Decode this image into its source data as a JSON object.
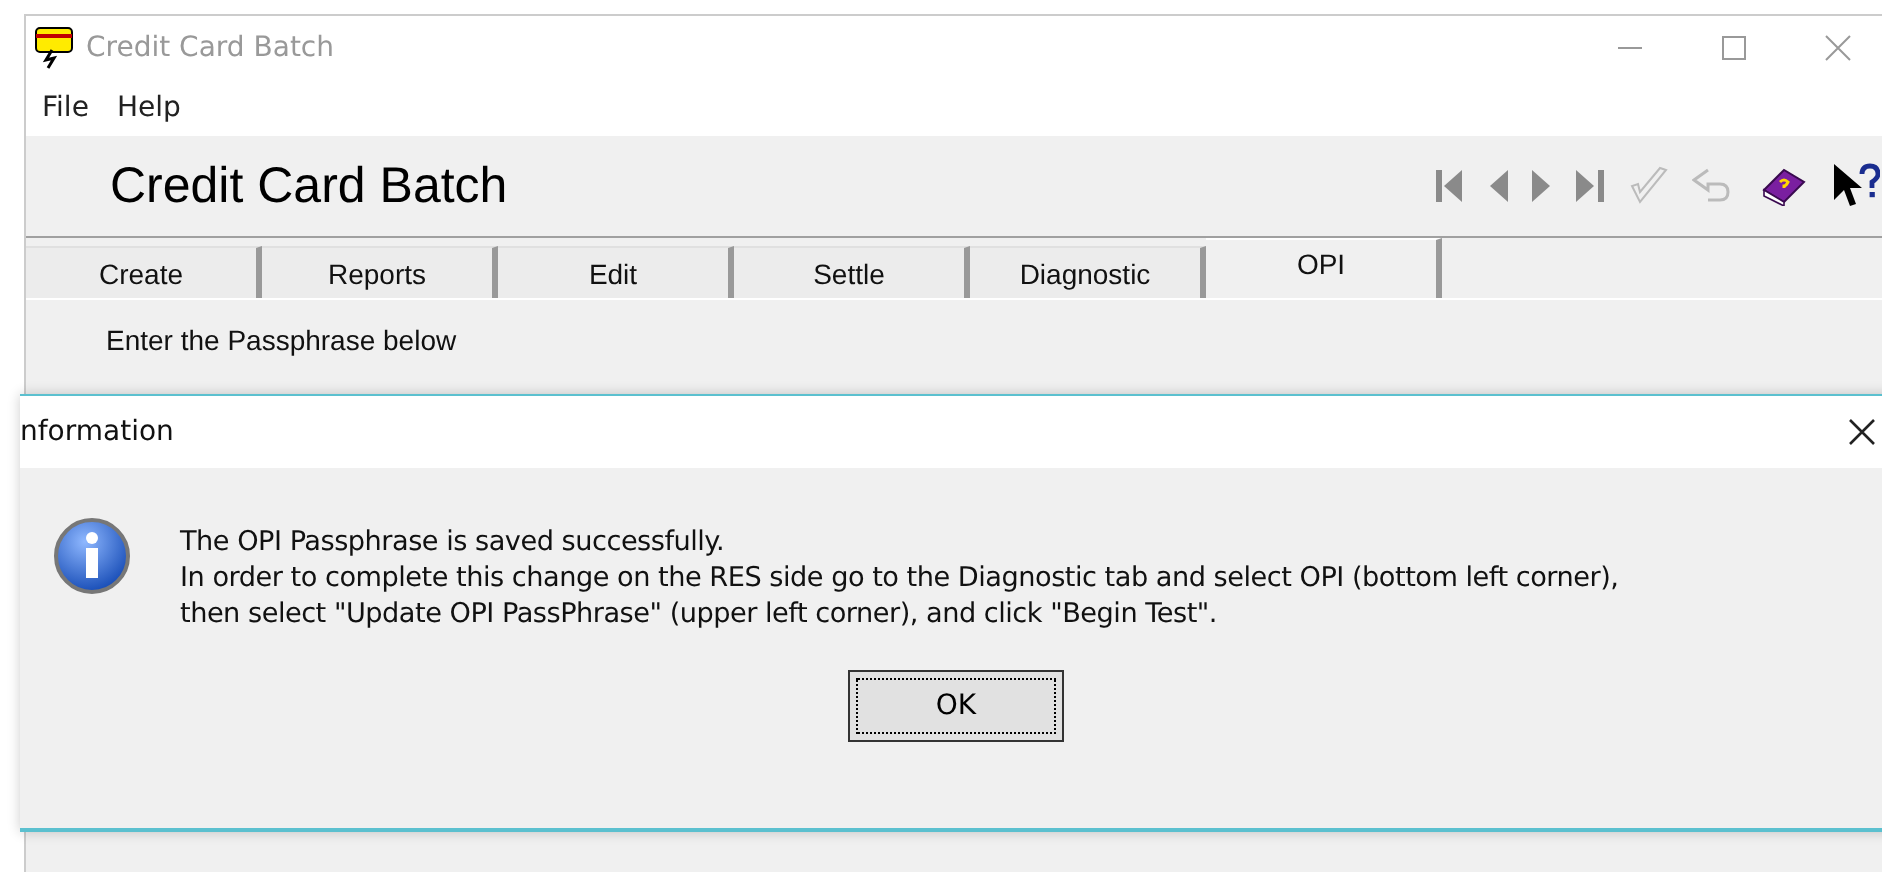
{
  "window": {
    "title": "Credit Card Batch"
  },
  "menu": [
    "File",
    "Help"
  ],
  "header": {
    "title": "Credit Card Batch"
  },
  "toolbar": [
    {
      "kind": "first",
      "disabled": true
    },
    {
      "kind": "prev",
      "disabled": true
    },
    {
      "kind": "next",
      "disabled": true
    },
    {
      "kind": "last",
      "disabled": true
    },
    {
      "kind": "check",
      "disabled": true
    },
    {
      "kind": "undo",
      "disabled": true
    },
    {
      "kind": "book",
      "disabled": false
    },
    {
      "kind": "pointer-help",
      "disabled": false
    }
  ],
  "tabs": [
    {
      "label": "Create",
      "selected": false
    },
    {
      "label": "Reports",
      "selected": false
    },
    {
      "label": "Edit",
      "selected": false
    },
    {
      "label": "Settle",
      "selected": false
    },
    {
      "label": "Diagnostic",
      "selected": false
    },
    {
      "label": "OPI",
      "selected": true
    }
  ],
  "content": {
    "prompt": "Enter the Passphrase below"
  },
  "dialog": {
    "title": "nformation",
    "lines": [
      "The OPI Passphrase is saved successfully.",
      "In order to complete this change on the RES side go to the Diagnostic tab and select OPI (bottom left corner),",
      "then select \"Update OPI PassPhrase\" (upper left corner), and click \"Begin Test\"."
    ],
    "button": "OK"
  }
}
